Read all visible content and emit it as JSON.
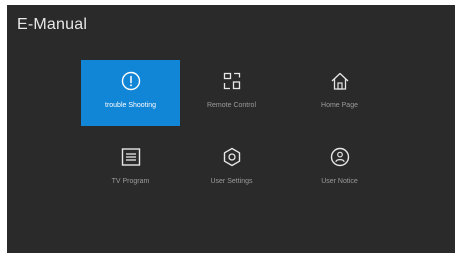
{
  "header": {
    "title": "E-Manual"
  },
  "theme": {
    "background": "#2a2a2b",
    "accent": "#1185d6",
    "icon_color": "#e6e6e6",
    "label_color": "#9a9a9a"
  },
  "menu": {
    "items": [
      {
        "label": "trouble Shooting",
        "icon": "alert-circle-icon",
        "selected": true
      },
      {
        "label": "Remote Control",
        "icon": "remote-control-icon",
        "selected": false
      },
      {
        "label": "Home Page",
        "icon": "home-icon",
        "selected": false
      },
      {
        "label": "TV Program",
        "icon": "tv-program-icon",
        "selected": false
      },
      {
        "label": "User Settings",
        "icon": "settings-hexagon-icon",
        "selected": false
      },
      {
        "label": "User Notice",
        "icon": "user-notice-icon",
        "selected": false
      }
    ]
  }
}
